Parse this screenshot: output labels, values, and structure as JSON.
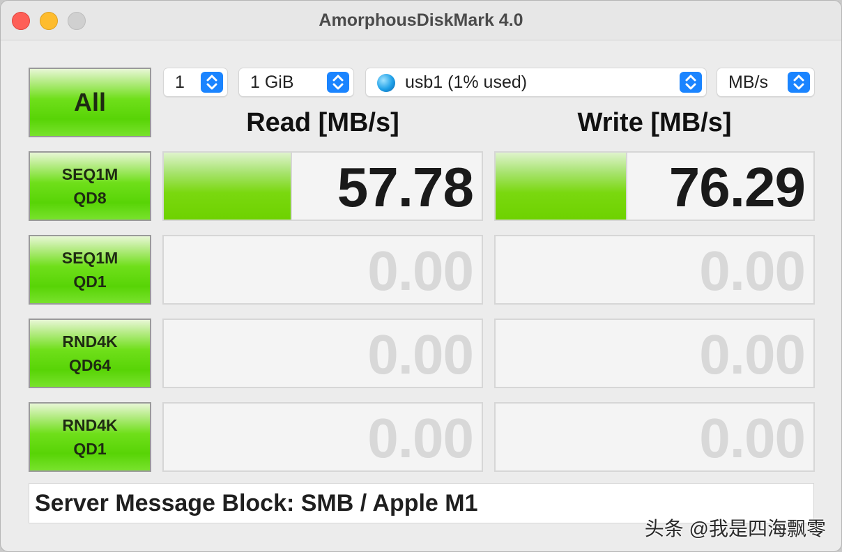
{
  "window": {
    "title": "AmorphousDiskMark 4.0"
  },
  "controls": {
    "count": "1",
    "size": "1 GiB",
    "disk": "usb1 (1% used)",
    "unit": "MB/s"
  },
  "headers": {
    "read": "Read [MB/s]",
    "write": "Write [MB/s]"
  },
  "all_button": "All",
  "tests": [
    {
      "line1": "SEQ1M",
      "line2": "QD8",
      "read": "57.78",
      "write": "76.29"
    },
    {
      "line1": "SEQ1M",
      "line2": "QD1",
      "read": "0.00",
      "write": "0.00"
    },
    {
      "line1": "RND4K",
      "line2": "QD64",
      "read": "0.00",
      "write": "0.00"
    },
    {
      "line1": "RND4K",
      "line2": "QD1",
      "read": "0.00",
      "write": "0.00"
    }
  ],
  "progress": {
    "seq1m_qd8_read_fraction": 0.4,
    "seq1m_qd8_write_fraction": 0.41
  },
  "comment": "Server Message Block: SMB / Apple M1",
  "watermark": "头条 @我是四海飘零",
  "colors": {
    "accent_blue": "#1a84ff",
    "result_green": "#6ed200",
    "inactive_text": "#d8d8d8"
  }
}
